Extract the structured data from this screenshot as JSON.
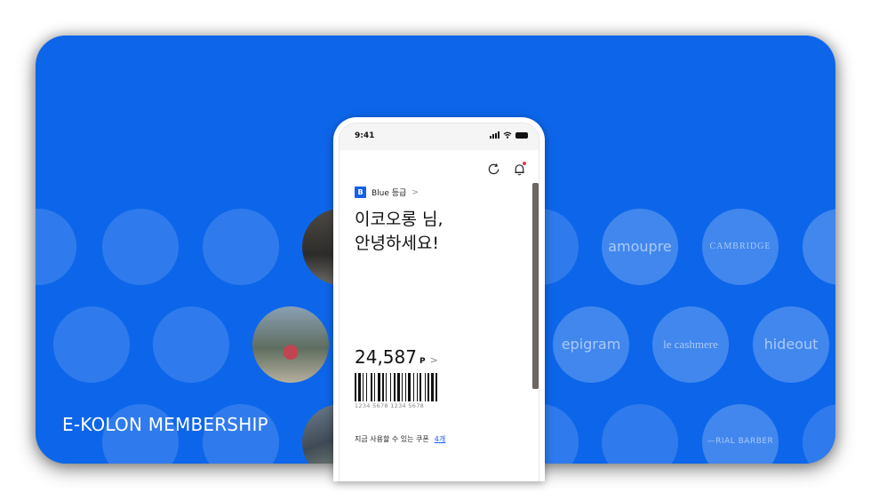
{
  "banner": {
    "title": "E-KOLON MEMBERSHIP",
    "background_color": "#0d66ea"
  },
  "brand_bubbles": {
    "row1": [
      "",
      "",
      "",
      "",
      "",
      "amoupre",
      "CAMBRIDGE",
      ""
    ],
    "row2": [
      "",
      "",
      "",
      "",
      "epigram",
      "le cashmere",
      "hideout"
    ],
    "row3": [
      "",
      "",
      "",
      "",
      "",
      "",
      "—RIAL BARBER",
      ""
    ]
  },
  "phone": {
    "status_time": "9:41",
    "grade": {
      "badge": "B",
      "label": "Blue 등급",
      "chevron": ">"
    },
    "greeting_line1": "이코오롱 님,",
    "greeting_line2": "안녕하세요!",
    "points": {
      "value": "24,587",
      "unit": "P",
      "chevron": ">"
    },
    "barcode_number": "1234 5678 1234 5678",
    "coupon": {
      "label": "지금 사용할 수 있는 쿠폰",
      "count": "4개"
    },
    "icons": [
      "refresh-icon",
      "bell-icon"
    ]
  }
}
